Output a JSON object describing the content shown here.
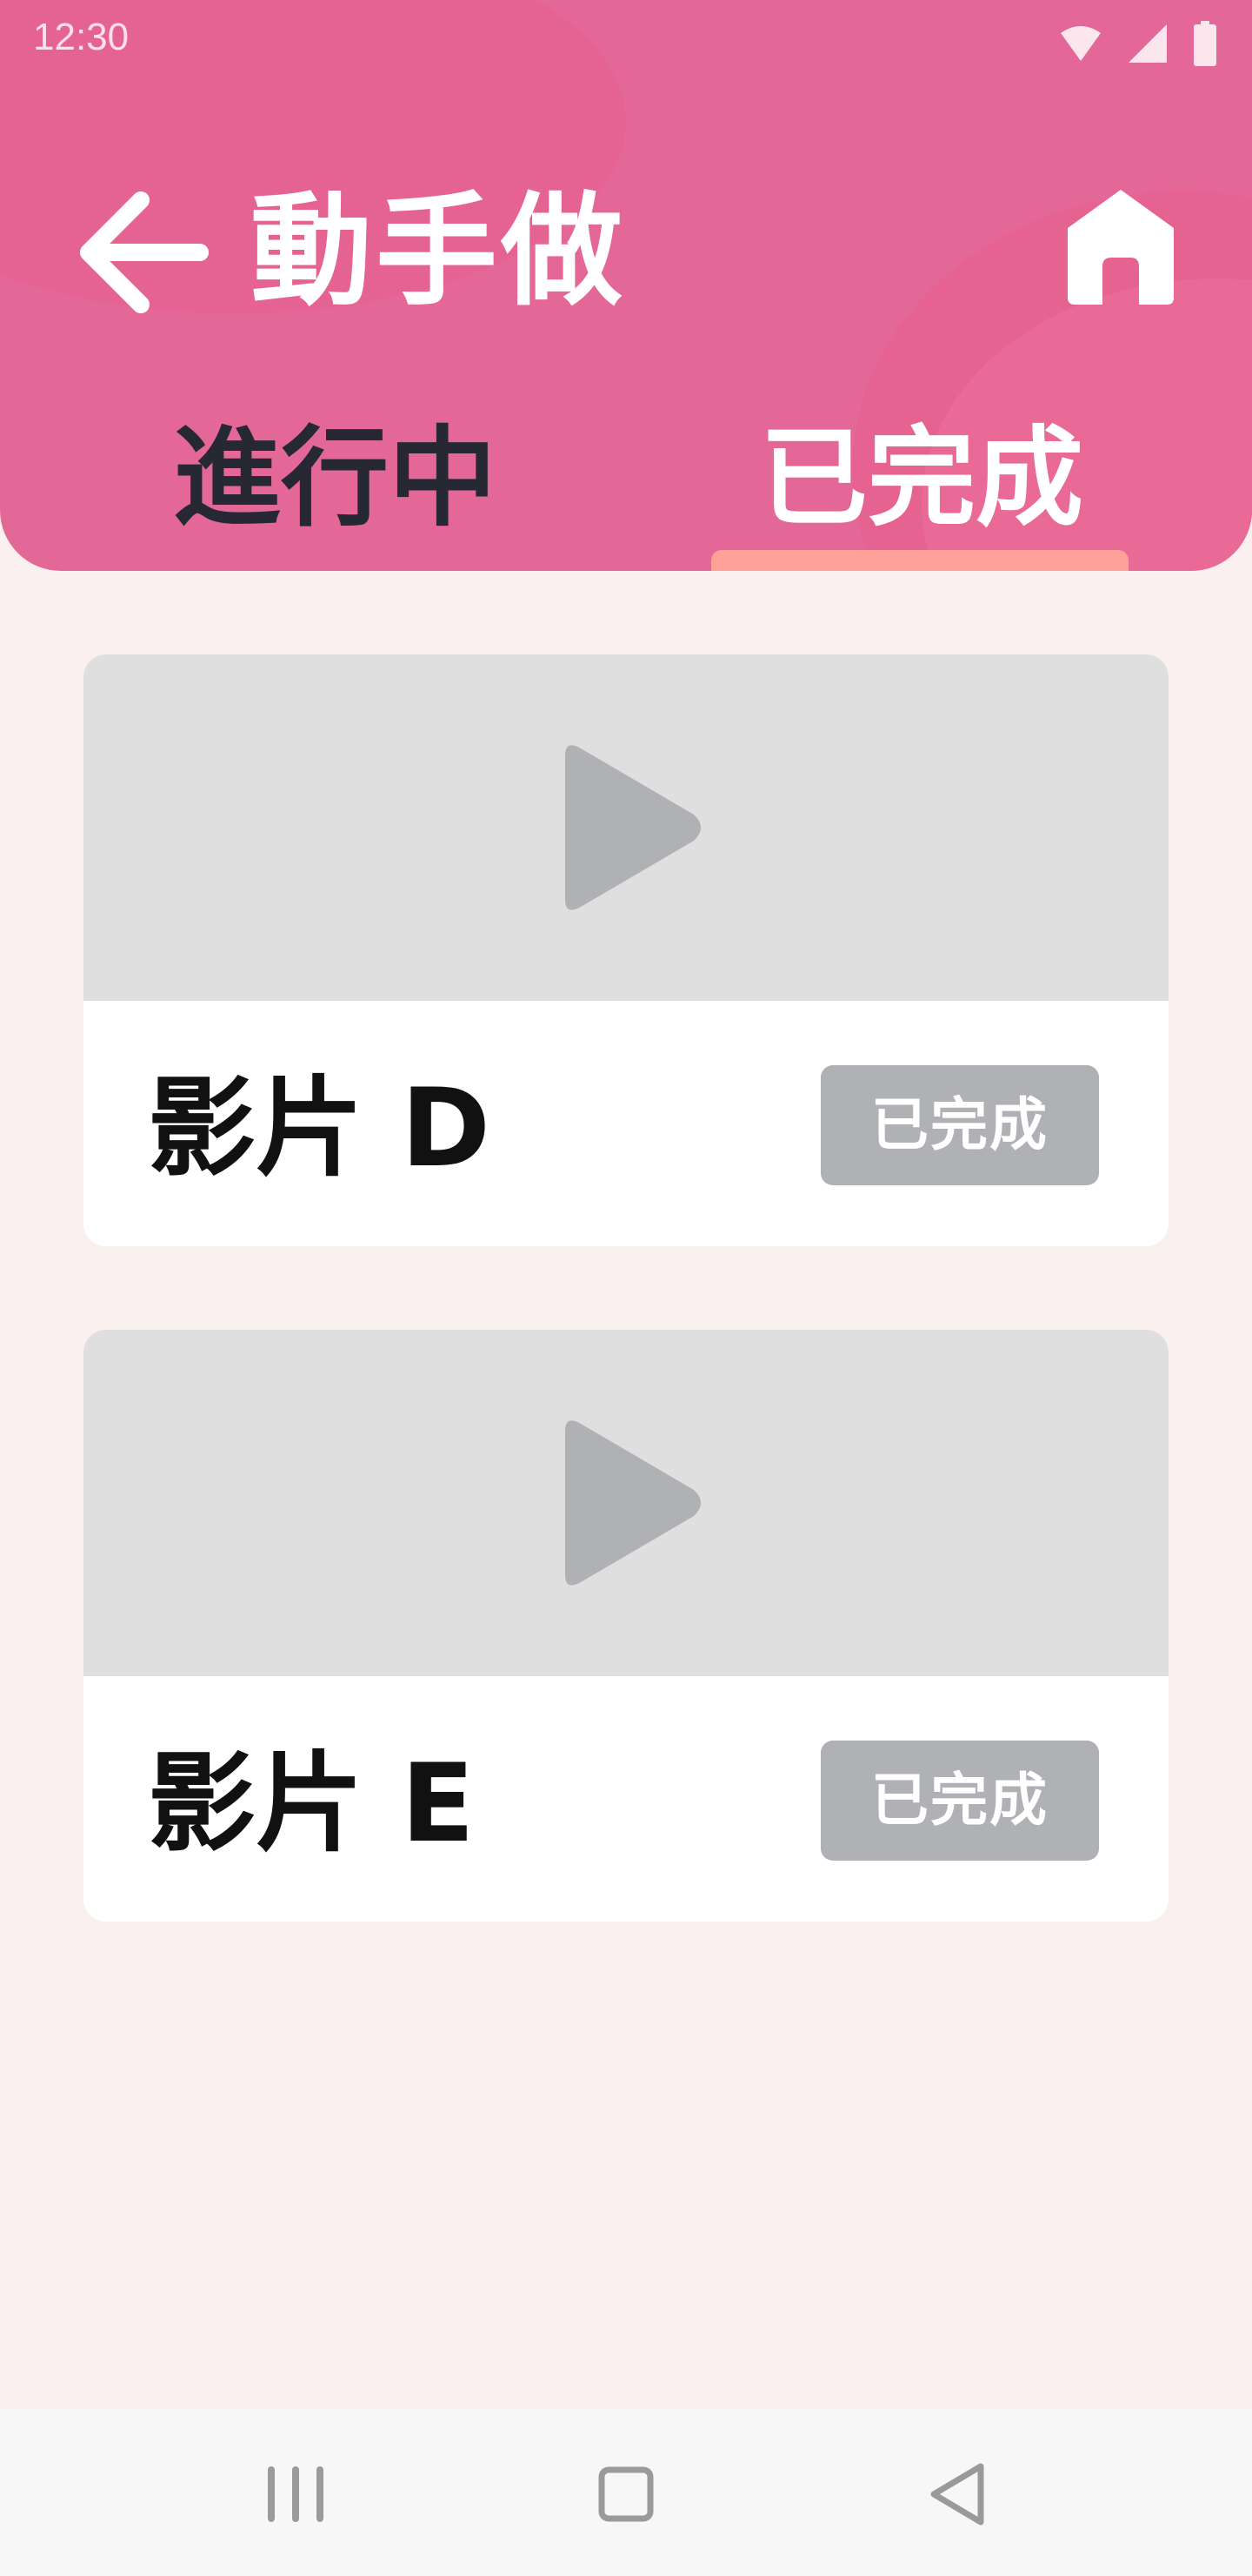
{
  "status_bar": {
    "time": "12:30",
    "icons": [
      "wifi-icon",
      "signal-icon",
      "battery-icon"
    ]
  },
  "header": {
    "title": "動手做",
    "back_icon": "arrow-left-icon",
    "home_icon": "home-icon",
    "background_color": "#e46897"
  },
  "tabs": [
    {
      "label": "進行中",
      "active": false,
      "color": "#262833"
    },
    {
      "label": "已完成",
      "active": true,
      "color": "#ffffff",
      "indicator_color": "#ffa199"
    }
  ],
  "videos": [
    {
      "title": "影片 D",
      "status": "已完成",
      "thumbnail_icon": "play-icon"
    },
    {
      "title": "影片 E",
      "status": "已完成",
      "thumbnail_icon": "play-icon"
    }
  ],
  "nav_bar": {
    "buttons": [
      "recents-icon",
      "home-square-icon",
      "back-triangle-icon"
    ]
  },
  "colors": {
    "page_background": "#faf0ef",
    "badge_background": "#b0b1b5",
    "thumbnail_background": "#dfdfdf"
  }
}
